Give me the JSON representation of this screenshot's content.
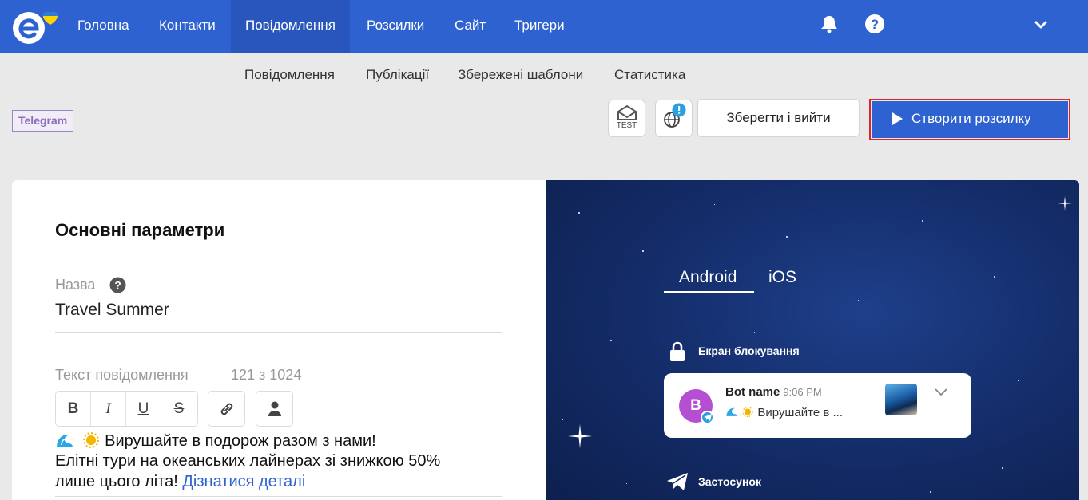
{
  "nav": {
    "items": [
      {
        "label": "Головна"
      },
      {
        "label": "Контакти"
      },
      {
        "label": "Повідомлення",
        "active": true
      },
      {
        "label": "Розсилки"
      },
      {
        "label": "Сайт"
      },
      {
        "label": "Тригери"
      }
    ],
    "icons": [
      "logo-icon",
      "bell-icon",
      "help-icon",
      "chevron-down-icon"
    ]
  },
  "subnav": {
    "items": [
      {
        "label": "Повідомлення"
      },
      {
        "label": "Публікації"
      },
      {
        "label": "Збережені шаблони"
      },
      {
        "label": "Статистика"
      }
    ]
  },
  "channel_tag": "Telegram",
  "toolbar": {
    "test_label": "TEST",
    "save_label": "Зберегти і вийти",
    "create_label": "Створити розсилку"
  },
  "form": {
    "section_title": "Основні параметри",
    "name_label": "Назва",
    "name_value": "Travel Summer",
    "text_label": "Текст повідомлення",
    "char_count": "121 з 1024",
    "format_buttons": [
      "B",
      "I",
      "U",
      "S"
    ],
    "message_line1": "Вирушайте в подорож разом з нами!",
    "message_line2": "Елітні тури на океанських лайнерах зі знижкою 50%",
    "message_line3_text": "лише цього літа! ",
    "message_link": "Дізнатися деталі"
  },
  "preview": {
    "tabs": [
      {
        "label": "Android",
        "active": true
      },
      {
        "label": "iOS"
      }
    ],
    "lock_screen_label": "Екран блокування",
    "notification": {
      "avatar_letter": "B",
      "bot_name": "Bot name",
      "time": "9:06 PM",
      "message": "Вирушайте в ..."
    },
    "app_label": "Застосунок"
  },
  "colors": {
    "brand_blue": "#2e62d0",
    "highlight_red": "#e0202b",
    "telegram_tag": "#8b6fbd",
    "preview_bg": "#132b66",
    "link": "#2e62d0"
  }
}
